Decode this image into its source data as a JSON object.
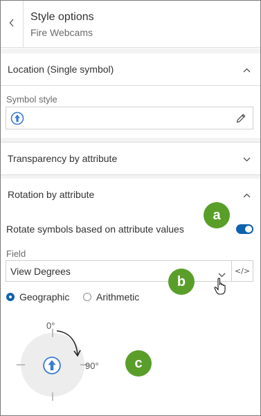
{
  "header": {
    "title": "Style options",
    "subtitle": "Fire Webcams"
  },
  "location": {
    "title": "Location (Single symbol)",
    "symbol_style_label": "Symbol style"
  },
  "transparency": {
    "title": "Transparency by attribute"
  },
  "rotation": {
    "title": "Rotation by attribute",
    "toggle_label": "Rotate symbols based on attribute values",
    "toggle_on": true,
    "field_label": "Field",
    "field_value": "View Degrees",
    "radio_geographic": "Geographic",
    "radio_arithmetic": "Arithmetic",
    "selected_mode": "Geographic",
    "dial_top": "0°",
    "dial_right": "90°"
  },
  "callouts": {
    "a": "a",
    "b": "b",
    "c": "c"
  },
  "colors": {
    "accent": "#0f62ae",
    "callout": "#5a9e2a"
  }
}
